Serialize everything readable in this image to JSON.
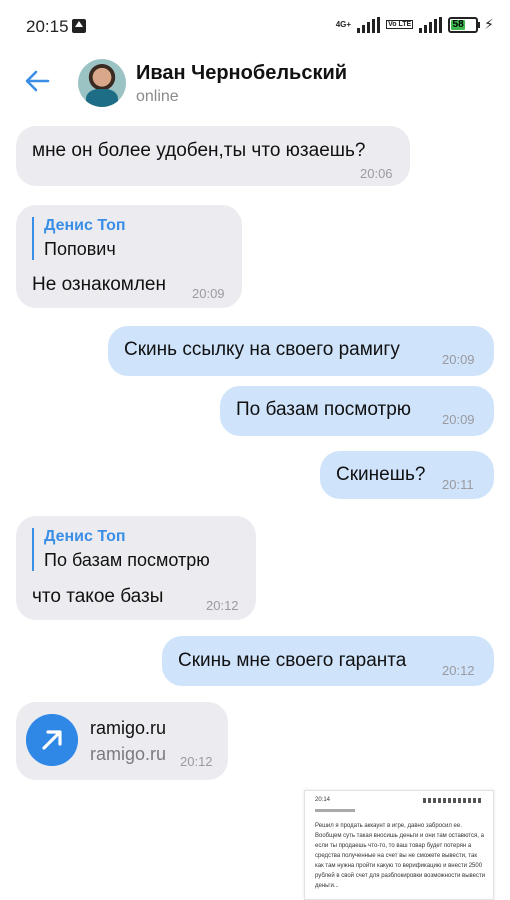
{
  "status_bar": {
    "time": "20:15",
    "network": "4G+",
    "volte": "Vo LTE",
    "battery": "58"
  },
  "header": {
    "contact_name": "Иван Чернобельский",
    "status": "online"
  },
  "messages": [
    {
      "direction": "in",
      "text": "мне он более удобен,ты что юзаешь?",
      "time": "20:06"
    },
    {
      "direction": "in",
      "reply_name": "Денис Топ",
      "reply_text": "Попович",
      "text": "Не ознакомлен",
      "time": "20:09"
    },
    {
      "direction": "out",
      "text": "Скинь ссылку на своего рамигу",
      "time": "20:09"
    },
    {
      "direction": "out",
      "text": "По базам посмотрю",
      "time": "20:09"
    },
    {
      "direction": "out",
      "text": "Скинешь?",
      "time": "20:11"
    },
    {
      "direction": "in",
      "reply_name": "Денис Топ",
      "reply_text": "По базам посмотрю",
      "text": "что такое базы",
      "time": "20:12"
    },
    {
      "direction": "out",
      "text": "Скинь мне своего гаранта",
      "time": "20:12"
    },
    {
      "direction": "in",
      "link_title": "ramigo.ru",
      "link_url": "ramigo.ru",
      "time": "20:12"
    }
  ],
  "attachment": {
    "thumb_time": "20:14",
    "thumb_text": "Решил я продать аккаунт в игре, давно забросил ее. Вообщем суть такая вносишь деньги и они там оставются, а если ты продаешь что-то, то ваш товар будет потерян а средства полученные на счет вы не сможете вывести, так как там нужна пройти какую то верификацию и внести 2500 рублей в свой счет для разблокировки возможности вывести деньги..."
  },
  "colors": {
    "incoming_bubble": "#ececf0",
    "outgoing_bubble": "#cfe3fb",
    "accent": "#3a8ee6",
    "battery": "#3fb94e"
  }
}
